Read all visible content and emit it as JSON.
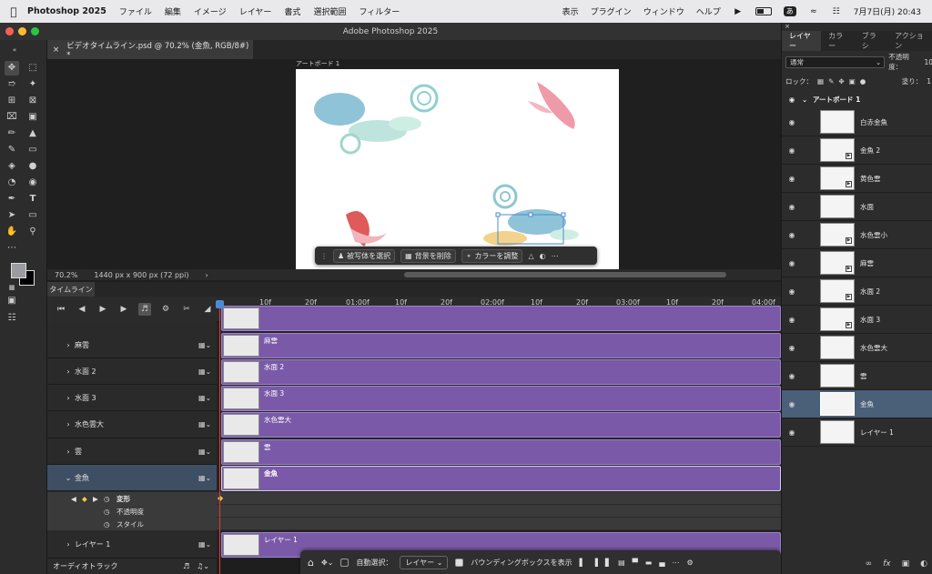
{
  "menubar": {
    "app_name": "Photoshop 2025",
    "items": [
      "ファイル",
      "編集",
      "イメージ",
      "レイヤー",
      "書式",
      "選択範囲",
      "フィルター"
    ],
    "right_items": [
      "表示",
      "プラグイン",
      "ウィンドウ",
      "ヘルプ"
    ],
    "input_badge": "あ",
    "datetime": "7月7日(月) 20:43"
  },
  "window": {
    "title": "Adobe Photoshop 2025"
  },
  "document_tab": {
    "title": "ビデオタイムライン.psd @ 70.2% (金魚, RGB/8#) *"
  },
  "canvas": {
    "artboard_label": "アートボード 1"
  },
  "context_bar": {
    "select_subject": "被写体を選択",
    "remove_bg": "背景を削除",
    "adjust_color": "カラーを調整"
  },
  "status": {
    "zoom": "70.2%",
    "doc_info": "1440 px x 900 px (72 ppi)"
  },
  "timeline": {
    "tab": "タイムライン",
    "ruler_ticks": [
      "10f",
      "20f",
      "01:00f",
      "10f",
      "20f",
      "02:00f",
      "10f",
      "20f",
      "03:00f",
      "10f",
      "20f",
      "04:00f"
    ],
    "tracks": [
      {
        "name": "麻雲",
        "clip": "麻雲"
      },
      {
        "name": "水面 2",
        "clip": "水面 2"
      },
      {
        "name": "水面 3",
        "clip": "水面 3"
      },
      {
        "name": "水色雲大",
        "clip": "水色雲大"
      },
      {
        "name": "雲",
        "clip": "雲"
      },
      {
        "name": "金魚",
        "clip": "金魚"
      },
      {
        "name": "レイヤー 1",
        "clip": "レイヤー 1"
      }
    ],
    "sub_props": [
      "変形",
      "不透明度",
      "スタイル"
    ],
    "audio_track": "オーディオトラック"
  },
  "taskbar": {
    "auto_select": "自動選択：",
    "target": "レイヤー",
    "bounding_box": "バウンディングボックスを表示"
  },
  "panels": {
    "tabs": [
      "レイヤー",
      "カラー",
      "ブラシ",
      "アクション"
    ],
    "blend_mode": "通常",
    "opacity_label": "不透明度：",
    "opacity_value": "10",
    "lock_label": "ロック：",
    "fill_label": "塗り：",
    "fill_value": "1",
    "artboard_name": "アートボード 1",
    "layers": [
      "白赤金魚",
      "金魚 2",
      "黄色雲",
      "水面",
      "水色雲小",
      "麻雲",
      "水面 2",
      "水面 3",
      "水色雲大",
      "雲",
      "金魚",
      "レイヤー 1"
    ]
  },
  "colors": {
    "clip_purple": "#7a5aa8",
    "selected_layer": "#4a5f78",
    "playhead": "#e23a3a"
  }
}
